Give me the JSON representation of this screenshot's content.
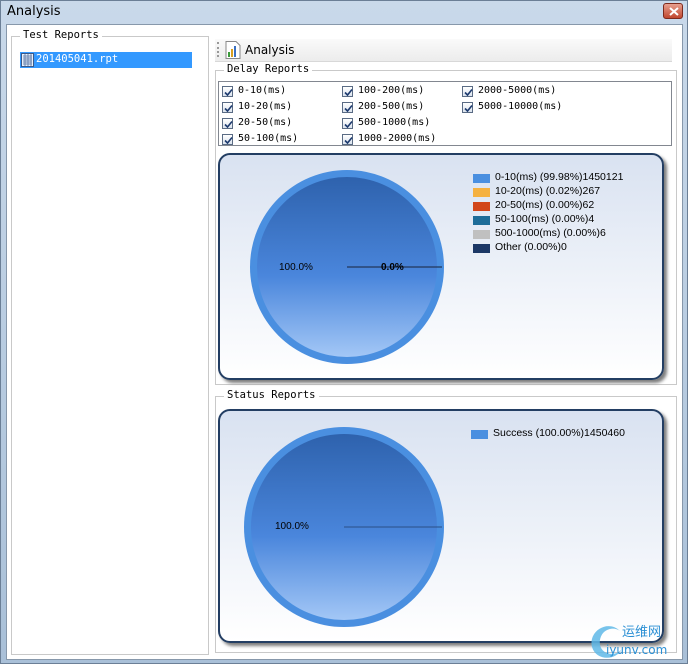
{
  "window": {
    "title": "Analysis"
  },
  "test_reports": {
    "legend": "Test Reports",
    "items": [
      "201405041.rpt"
    ]
  },
  "toolbar": {
    "analysis_label": "Analysis"
  },
  "delay_reports": {
    "legend": "Delay  Reports",
    "checkboxes": [
      {
        "label": "0-10(ms)",
        "checked": true
      },
      {
        "label": "10-20(ms)",
        "checked": true
      },
      {
        "label": "20-50(ms)",
        "checked": true
      },
      {
        "label": "50-100(ms)",
        "checked": true
      },
      {
        "label": "100-200(ms)",
        "checked": true
      },
      {
        "label": "200-500(ms)",
        "checked": true
      },
      {
        "label": "500-1000(ms)",
        "checked": true
      },
      {
        "label": "1000-2000(ms)",
        "checked": true
      },
      {
        "label": "2000-5000(ms)",
        "checked": true
      },
      {
        "label": "5000-10000(ms)",
        "checked": true
      }
    ]
  },
  "status_reports": {
    "legend": "Status Reports"
  },
  "colors": {
    "pie_blue": "#4a8fe0",
    "pie_dark": "#2a5fa8",
    "accent": "#3399ff"
  },
  "watermark": {
    "text": "运维网",
    "sub": "iyunv.com"
  },
  "chart_data": [
    {
      "type": "pie",
      "legend": [
        {
          "label": "0-10(ms) (99.98%)1450121",
          "color": "#4a8fe0"
        },
        {
          "label": "10-20(ms) (0.02%)267",
          "color": "#f5b140"
        },
        {
          "label": "20-50(ms) (0.00%)62",
          "color": "#d2461a"
        },
        {
          "label": "50-100(ms) (0.00%)4",
          "color": "#1e6d99"
        },
        {
          "label": "500-1000(ms) (0.00%)6",
          "color": "#c0c0c0"
        },
        {
          "label": "Other (0.00%)0",
          "color": "#1c3866"
        }
      ],
      "slices": [
        {
          "name": "0-10(ms)",
          "value": 1450121
        },
        {
          "name": "10-20(ms)",
          "value": 267
        },
        {
          "name": "20-50(ms)",
          "value": 62
        },
        {
          "name": "50-100(ms)",
          "value": 4
        },
        {
          "name": "500-1000(ms)",
          "value": 6
        },
        {
          "name": "Other",
          "value": 0
        }
      ],
      "slice_labels": [
        "100.0%",
        "0.0%"
      ],
      "legend_position": "top-right"
    },
    {
      "type": "pie",
      "legend": [
        {
          "label": "Success (100.00%)1450460",
          "color": "#4a8fe0"
        }
      ],
      "slices": [
        {
          "name": "Success",
          "value": 1450460
        }
      ],
      "slice_labels": [
        "100.0%"
      ],
      "legend_position": "top-right"
    }
  ]
}
